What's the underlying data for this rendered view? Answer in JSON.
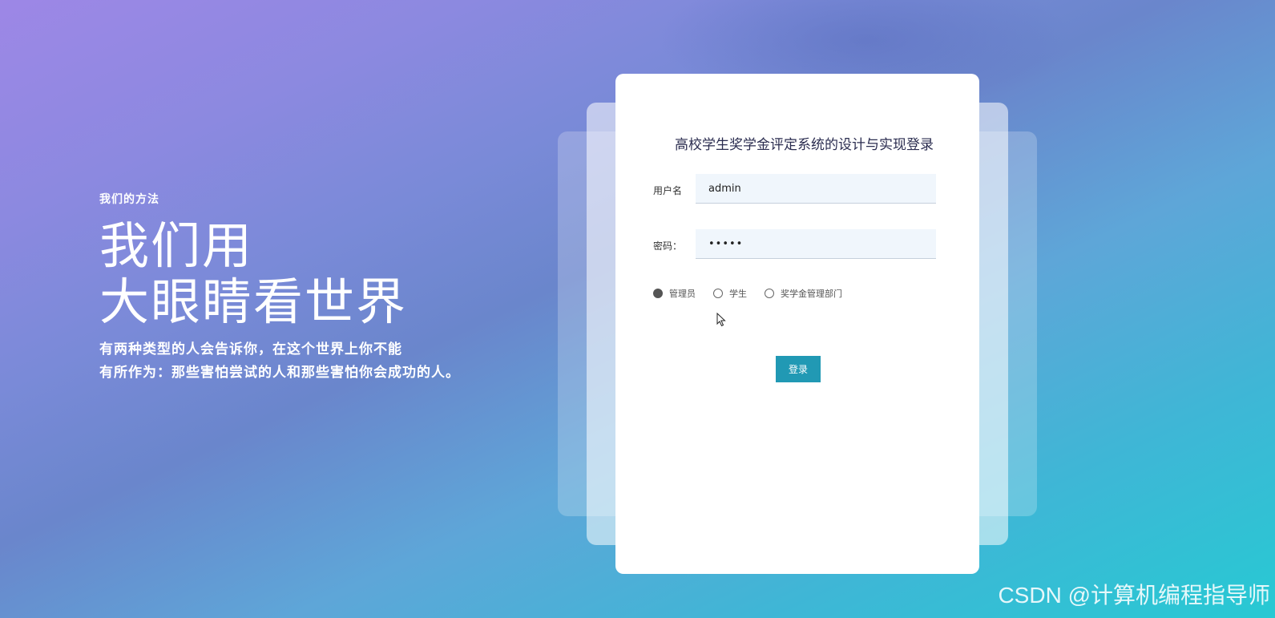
{
  "hero": {
    "eyebrow": "我们的方法",
    "headline_line1": "我们用",
    "headline_line2": "大眼睛看世界",
    "desc_line1": "有两种类型的人会告诉你，在这个世界上你不能",
    "desc_line2": "有所作为：那些害怕尝试的人和那些害怕你会成功的人。"
  },
  "login": {
    "title": "高校学生奖学金评定系统的设计与实现登录",
    "username_label": "用户名",
    "username_value": "admin",
    "password_label": "密码：",
    "password_value": "•••••",
    "roles": [
      {
        "label": "管理员",
        "selected": true
      },
      {
        "label": "学生",
        "selected": false
      },
      {
        "label": "奖学金管理部门",
        "selected": false
      }
    ],
    "submit_label": "登录"
  },
  "watermark": "CSDN @计算机编程指导师",
  "colors": {
    "button": "#2199b4",
    "input_bg": "#f0f6fc"
  }
}
